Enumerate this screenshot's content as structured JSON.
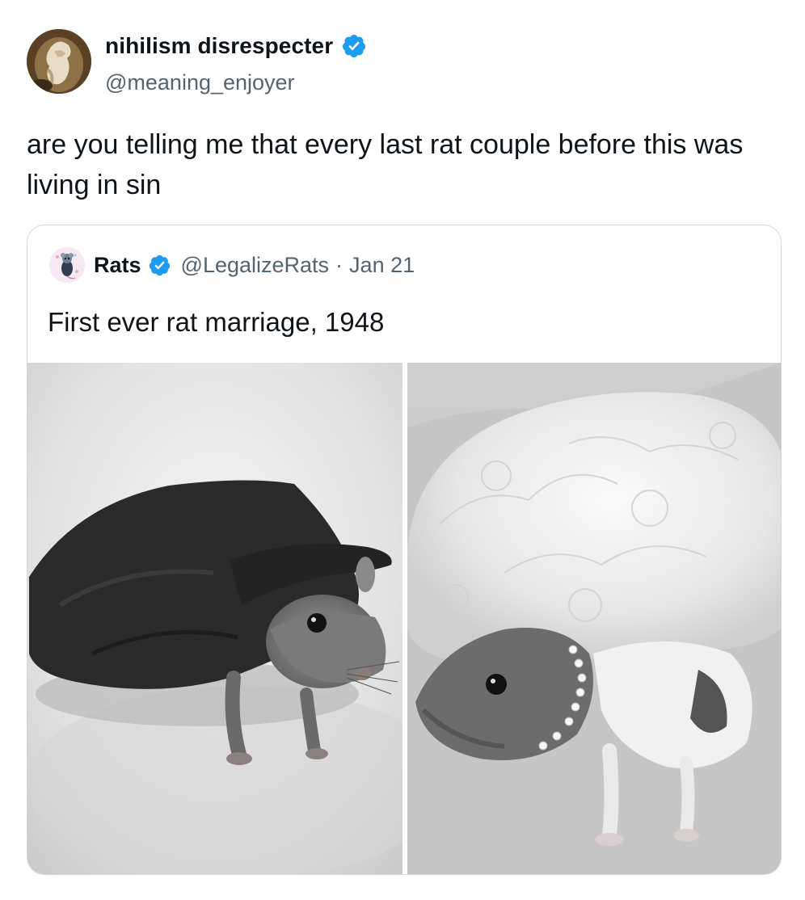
{
  "tweet": {
    "author": {
      "name": "nihilism disrespecter",
      "handle": "@meaning_enjoyer",
      "avatar_icon": "statue-avatar",
      "verified": true
    },
    "text": "are you telling me that every last rat couple before this was living in sin"
  },
  "quoted_tweet": {
    "author": {
      "name": "Rats",
      "handle": "@LegalizeRats",
      "avatar_icon": "rat-avatar",
      "verified": true
    },
    "separator": "·",
    "date": "Jan 21",
    "text": "First ever rat marriage, 1948",
    "media": [
      {
        "icon": "rat-in-black-cape-photo"
      },
      {
        "icon": "rat-in-lace-bonnet-photo"
      }
    ]
  },
  "colors": {
    "verified_blue": "#1d9bf0",
    "text_primary": "#0f1419",
    "text_secondary": "#536471",
    "card_border": "#cfd9de"
  }
}
